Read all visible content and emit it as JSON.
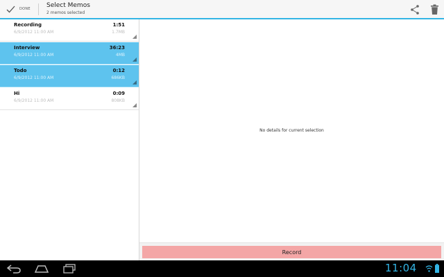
{
  "action_bar": {
    "done_label": "DONE",
    "title": "Select Memos",
    "subtitle": "2 memos selected",
    "accent_color": "#33b5e5"
  },
  "memos": [
    {
      "title": "Recording",
      "date": "6/9/2012 11:00 AM",
      "duration": "1:51",
      "size": "1.7MB",
      "selected": false
    },
    {
      "title": "Interview",
      "date": "6/9/2012 11:00 AM",
      "duration": "36:23",
      "size": "4MB",
      "selected": true
    },
    {
      "title": "Todo",
      "date": "6/9/2012 11:00 AM",
      "duration": "0:12",
      "size": "686KB",
      "selected": true
    },
    {
      "title": "Hi",
      "date": "6/9/2012 11:00 AM",
      "duration": "0:09",
      "size": "808KB",
      "selected": false
    }
  ],
  "details": {
    "empty_message": "No details for current selection"
  },
  "record": {
    "label": "Record",
    "color": "#f4a6a6"
  },
  "system_bar": {
    "clock": "11:04",
    "icons": [
      "back-icon",
      "home-icon",
      "recent-apps-icon",
      "wifi-icon",
      "battery-icon"
    ]
  }
}
